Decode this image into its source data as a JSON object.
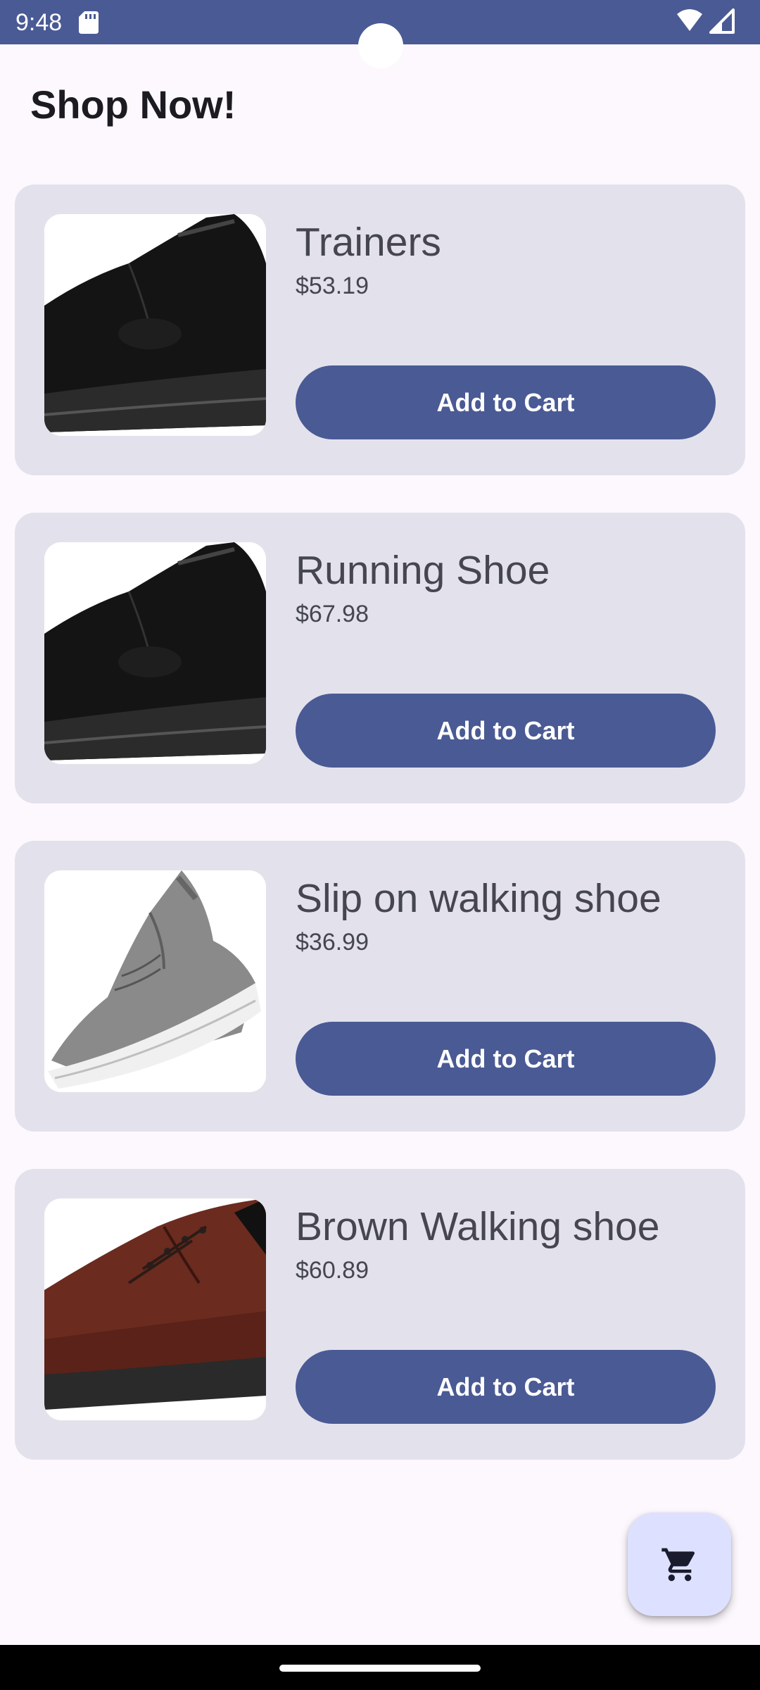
{
  "status_bar": {
    "time": "9:48",
    "icons": [
      "sd-card-icon",
      "wifi-icon",
      "cell-signal-icon"
    ]
  },
  "header": {
    "title": "Shop Now!"
  },
  "products": [
    {
      "name": "Trainers",
      "price": "$53.19",
      "button_label": "Add to Cart",
      "image": "black-trainer-image"
    },
    {
      "name": "Running Shoe",
      "price": "$67.98",
      "button_label": "Add to Cart",
      "image": "black-trainer-image"
    },
    {
      "name": "Slip on walking shoe",
      "price": "$36.99",
      "button_label": "Add to Cart",
      "image": "grey-knit-sneaker-image"
    },
    {
      "name": "Brown Walking shoe",
      "price": "$60.89",
      "button_label": "Add to Cart",
      "image": "brown-leather-shoe-image"
    }
  ],
  "fab": {
    "icon": "shopping-cart-icon"
  },
  "colors": {
    "primary": "#4a5a95",
    "card_background": "#e3e2ec",
    "background": "#fdf8fd",
    "fab_background": "#dde1ff",
    "text": "#45464f"
  }
}
